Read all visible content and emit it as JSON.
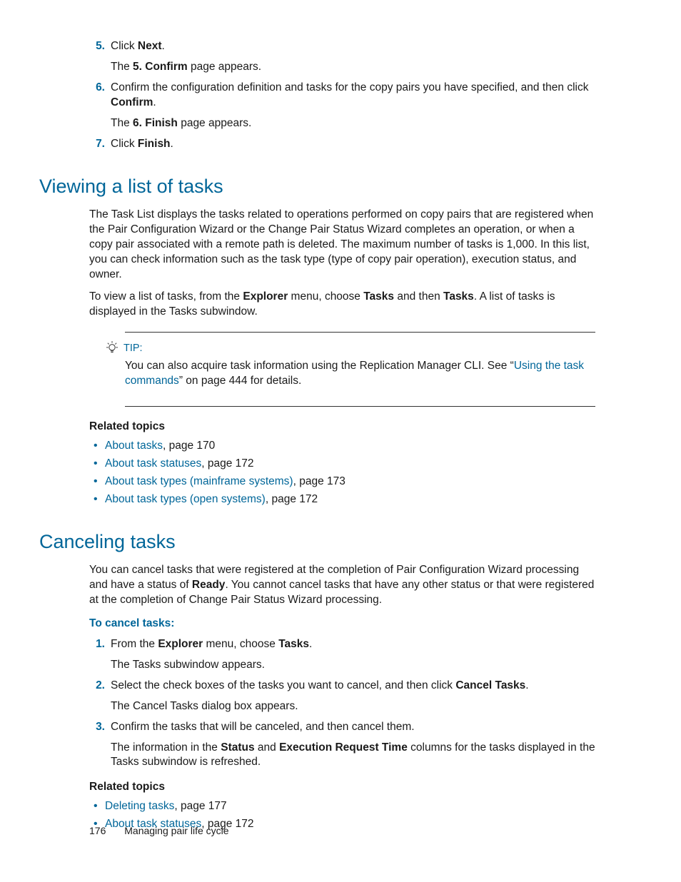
{
  "top_steps": [
    {
      "num": "5.",
      "lines": [
        [
          {
            "t": "Click "
          },
          {
            "t": "Next",
            "b": true
          },
          {
            "t": "."
          }
        ],
        [
          {
            "t": "The "
          },
          {
            "t": "5. Confirm",
            "b": true
          },
          {
            "t": " page appears."
          }
        ]
      ]
    },
    {
      "num": "6.",
      "lines": [
        [
          {
            "t": "Confirm the configuration definition and tasks for the copy pairs you have specified, and then click "
          },
          {
            "t": "Confirm",
            "b": true
          },
          {
            "t": "."
          }
        ],
        [
          {
            "t": "The "
          },
          {
            "t": "6. Finish",
            "b": true
          },
          {
            "t": " page appears."
          }
        ]
      ]
    },
    {
      "num": "7.",
      "lines": [
        [
          {
            "t": "Click "
          },
          {
            "t": "Finish",
            "b": true
          },
          {
            "t": "."
          }
        ]
      ]
    }
  ],
  "sec_viewing": {
    "title": "Viewing a list of tasks",
    "paras": [
      [
        {
          "t": "The Task List displays the tasks related to operations performed on copy pairs that are registered when the Pair Configuration Wizard or the Change Pair Status Wizard completes an operation, or when a copy pair associated with a remote path is deleted. The maximum number of tasks is 1,000.  In this list, you can check information such as the task type (type of copy pair operation), execution status, and owner."
        }
      ],
      [
        {
          "t": "To view a list of tasks, from the "
        },
        {
          "t": "Explorer",
          "b": true
        },
        {
          "t": " menu, choose "
        },
        {
          "t": "Tasks",
          "b": true
        },
        {
          "t": " and then "
        },
        {
          "t": "Tasks",
          "b": true
        },
        {
          "t": ". A list of tasks is displayed in the Tasks subwindow."
        }
      ]
    ],
    "tip": {
      "label": "TIP:",
      "runs": [
        {
          "t": "You can also acquire task information using the Replication Manager CLI. See “"
        },
        {
          "t": "Using the task commands",
          "link": true
        },
        {
          "t": "” on page 444 for details."
        }
      ]
    },
    "related_head": "Related topics",
    "related": [
      [
        {
          "t": "About tasks",
          "link": true
        },
        {
          "t": ", page 170"
        }
      ],
      [
        {
          "t": "About task statuses",
          "link": true
        },
        {
          "t": ", page 172"
        }
      ],
      [
        {
          "t": "About task types (mainframe systems)",
          "link": true
        },
        {
          "t": ", page 173"
        }
      ],
      [
        {
          "t": "About task types (open systems)",
          "link": true
        },
        {
          "t": ", page 172"
        }
      ]
    ]
  },
  "sec_cancel": {
    "title": "Canceling tasks",
    "paras": [
      [
        {
          "t": "You can cancel tasks that were registered at the completion of Pair Configuration Wizard processing and have a status of "
        },
        {
          "t": "Ready",
          "b": true
        },
        {
          "t": ". You cannot cancel tasks that have any other status or that were registered at the completion of Change Pair Status Wizard processing."
        }
      ]
    ],
    "procedure_head": "To cancel tasks:",
    "steps": [
      {
        "num": "1.",
        "lines": [
          [
            {
              "t": "From the "
            },
            {
              "t": "Explorer",
              "b": true
            },
            {
              "t": " menu, choose "
            },
            {
              "t": "Tasks",
              "b": true
            },
            {
              "t": "."
            }
          ],
          [
            {
              "t": "The Tasks subwindow appears."
            }
          ]
        ]
      },
      {
        "num": "2.",
        "lines": [
          [
            {
              "t": "Select the check boxes of the tasks you want to cancel, and then click "
            },
            {
              "t": "Cancel Tasks",
              "b": true
            },
            {
              "t": "."
            }
          ],
          [
            {
              "t": "The Cancel Tasks dialog box appears."
            }
          ]
        ]
      },
      {
        "num": "3.",
        "lines": [
          [
            {
              "t": "Confirm the tasks that will be canceled, and then cancel them."
            }
          ],
          [
            {
              "t": "The information in the "
            },
            {
              "t": "Status",
              "b": true
            },
            {
              "t": " and "
            },
            {
              "t": "Execution Request Time",
              "b": true
            },
            {
              "t": " columns for the tasks displayed in the Tasks subwindow is refreshed."
            }
          ]
        ]
      }
    ],
    "related_head": "Related topics",
    "related": [
      [
        {
          "t": "Deleting tasks",
          "link": true
        },
        {
          "t": ", page 177"
        }
      ],
      [
        {
          "t": "About task statuses",
          "link": true
        },
        {
          "t": ", page 172"
        }
      ]
    ]
  },
  "footer": {
    "page_num": "176",
    "chapter": "Managing pair life cycle"
  }
}
